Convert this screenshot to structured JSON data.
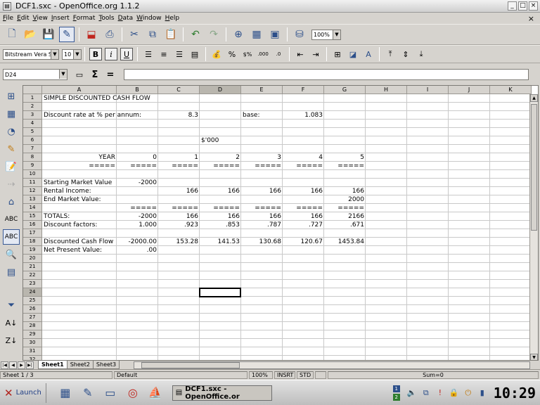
{
  "window": {
    "title": "DCF1.sxc - OpenOffice.org 1.1.2",
    "app_icon": "document-icon"
  },
  "menu": [
    "File",
    "Edit",
    "View",
    "Insert",
    "Format",
    "Tools",
    "Data",
    "Window",
    "Help"
  ],
  "toolbar": {
    "zoom": "100%",
    "font_name": "Bitstream Vera S",
    "font_size": "10",
    "bold": "B",
    "italic": "i",
    "underline": "U",
    "percent": "%",
    "currency": "$%",
    "add_decimal": ".000",
    "del_decimal": ".0"
  },
  "formula": {
    "name_box": "D24",
    "sum_symbol": "Σ",
    "equals_symbol": "="
  },
  "columns": [
    "A",
    "B",
    "C",
    "D",
    "E",
    "F",
    "G",
    "H",
    "I",
    "J",
    "K"
  ],
  "selected_column": "D",
  "rows": [
    "1",
    "2",
    "3",
    "4",
    "5",
    "6",
    "7",
    "8",
    "9",
    "10",
    "11",
    "12",
    "13",
    "14",
    "15",
    "16",
    "17",
    "18",
    "19",
    "20",
    "21",
    "22",
    "23",
    "24",
    "25",
    "26",
    "27",
    "28",
    "29",
    "30",
    "31",
    "32"
  ],
  "selected_row": "24",
  "cells": {
    "A1": "SIMPLE DISCOUNTED CASH FLOW",
    "A3": "Discount rate at % per annum:",
    "C3": "8.3",
    "E3": "base:",
    "F3": "1.083",
    "D6": "$'000",
    "A8": "YEAR",
    "B8": "0",
    "C8": "1",
    "D8": "2",
    "E8": "3",
    "F8": "4",
    "G8": "5",
    "A9": "=====",
    "B9": "=====",
    "C9": "=====",
    "D9": "=====",
    "E9": "=====",
    "F9": "=====",
    "G9": "=====",
    "A11": "Starting Market Value",
    "B11": "-2000",
    "A12": "Rental Income:",
    "C12": "166",
    "D12": "166",
    "E12": "166",
    "F12": "166",
    "G12": "166",
    "A13": "End Market Value:",
    "G13": "2000",
    "B14": "=====",
    "C14": "=====",
    "D14": "=====",
    "E14": "=====",
    "F14": "=====",
    "G14": "=====",
    "A15": "TOTALS:",
    "B15": "-2000",
    "C15": "166",
    "D15": "166",
    "E15": "166",
    "F15": "166",
    "G15": "2166",
    "A16": "Discount factors:",
    "B16": "1.000",
    "C16": ".923",
    "D16": ".853",
    "E16": ".787",
    "F16": ".727",
    "G16": ".671",
    "A18": "Discounted Cash Flow",
    "B18": "-2000.00",
    "C18": "153.28",
    "D18": "141.53",
    "E18": "130.68",
    "F18": "120.67",
    "G18": "1453.84",
    "A19": "Net Present Value:",
    "B19": ".00"
  },
  "sheet_tabs": [
    "Sheet1",
    "Sheet2",
    "Sheet3"
  ],
  "active_sheet": "Sheet1",
  "status": {
    "sheet": "Sheet 1 / 3",
    "style": "Default",
    "zoom": "100%",
    "insert": "INSRT",
    "std": "STD",
    "sum": "Sum=0"
  },
  "taskbar": {
    "launch": "Launch",
    "window_title": "DCF1.sxc - OpenOffice.or",
    "desktop_1": "1",
    "desktop_2": "2",
    "clock": "10:29"
  }
}
